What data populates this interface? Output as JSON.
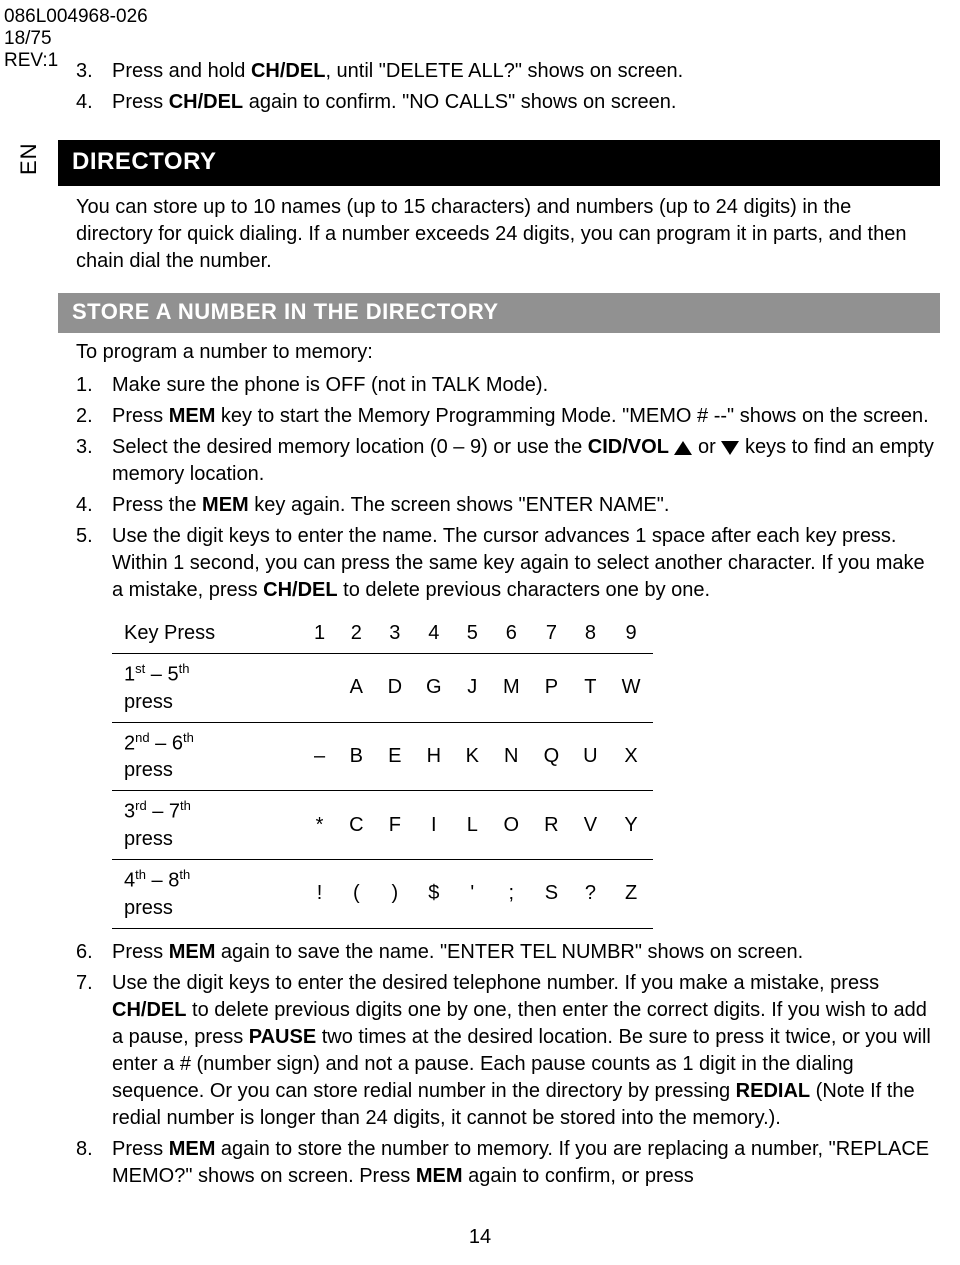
{
  "meta": {
    "code": "086L004968-026",
    "page": "18/75",
    "rev": "REV:1"
  },
  "side_lang": "EN",
  "intro_list": [
    {
      "n": "3.",
      "segs": [
        {
          "t": "Press and hold "
        },
        {
          "t": "CH/DEL",
          "b": true
        },
        {
          "t": ", until \"DELETE ALL?\" shows on screen."
        }
      ]
    },
    {
      "n": "4.",
      "segs": [
        {
          "t": "Press "
        },
        {
          "t": "CH/DEL",
          "b": true
        },
        {
          "t": " again to confirm. \"NO CALLS\" shows on screen."
        }
      ]
    }
  ],
  "h1": "DIRECTORY",
  "directory_intro": "You can store up to 10 names (up to 15 characters) and numbers (up to 24 digits) in the directory for quick dialing. If a number exceeds 24 digits, you can program it in parts, and then chain dial the number.",
  "h2": "STORE A NUMBER IN THE DIRECTORY",
  "store_lead": "To program a number to memory:",
  "store_list": [
    {
      "n": "1.",
      "segs": [
        {
          "t": "Make sure the phone is OFF (not in TALK Mode)."
        }
      ]
    },
    {
      "n": "2.",
      "segs": [
        {
          "t": "Press "
        },
        {
          "t": "MEM",
          "b": true
        },
        {
          "t": " key to start the Memory Programming Mode.  \"MEMO # --\"  shows on the screen."
        }
      ]
    },
    {
      "n": "3.",
      "segs": [
        {
          "t": "Select the desired memory location (0 – 9) or use the "
        },
        {
          "t": "CID/VOL",
          "b": true
        },
        {
          "t": " "
        },
        {
          "icon": "up"
        },
        {
          "t": " or "
        },
        {
          "icon": "down"
        },
        {
          "t": " keys to find an empty memory location."
        }
      ]
    },
    {
      "n": "4.",
      "segs": [
        {
          "t": "Press the "
        },
        {
          "t": "MEM",
          "b": true
        },
        {
          "t": " key again.  The screen shows \"ENTER NAME\"."
        }
      ]
    },
    {
      "n": "5.",
      "segs": [
        {
          "t": "Use the digit keys to enter the name.  The cursor advances 1 space after each key press.  Within 1 second, you can press the same key again to select another character. If you make a mistake, press "
        },
        {
          "t": "CH/DEL",
          "b": true
        },
        {
          "t": " to delete previous characters one by one."
        }
      ]
    }
  ],
  "char_table": {
    "header": [
      "Key Press",
      "1",
      "2",
      "3",
      "4",
      "5",
      "6",
      "7",
      "8",
      "9"
    ],
    "rows": [
      {
        "label_html": "1<sup>st</sup> – 5<sup>th</sup> press",
        "cells": [
          "",
          "A",
          "D",
          "G",
          "J",
          "M",
          "P",
          "T",
          "W"
        ]
      },
      {
        "label_html": "2<sup>nd</sup> – 6<sup>th</sup> press",
        "cells": [
          "–",
          "B",
          "E",
          "H",
          "K",
          "N",
          "Q",
          "U",
          "X"
        ]
      },
      {
        "label_html": "3<sup>rd</sup> – 7<sup>th</sup> press",
        "cells": [
          "*",
          "C",
          "F",
          "I",
          "L",
          "O",
          "R",
          "V",
          "Y"
        ]
      },
      {
        "label_html": "4<sup>th</sup> – 8<sup>th</sup> press",
        "cells": [
          "!",
          "(",
          ")",
          "$",
          "'",
          ";",
          "S",
          "?",
          "Z"
        ]
      }
    ]
  },
  "store_list2": [
    {
      "n": "6.",
      "segs": [
        {
          "t": "Press "
        },
        {
          "t": "MEM",
          "b": true
        },
        {
          "t": " again to save the name.  \"ENTER TEL NUMBR\" shows on screen."
        }
      ]
    },
    {
      "n": "7.",
      "segs": [
        {
          "t": "Use the digit keys to enter the desired telephone number. If you make a mistake, press "
        },
        {
          "t": "CH/DEL",
          "b": true
        },
        {
          "t": " to delete previous digits one by one, then enter the correct digits. If you wish to add a pause, press "
        },
        {
          "t": "PAUSE",
          "b": true
        },
        {
          "t": " two times at the desired location. Be sure to press it twice, or you will enter a # (number sign) and not a pause.  Each pause counts as 1 digit in the dialing sequence. Or you can store redial number in the directory by pressing "
        },
        {
          "t": "REDIAL",
          "b": true
        },
        {
          "t": " (Note If the redial number is longer than 24 digits, it cannot be stored into the memory.)."
        }
      ]
    },
    {
      "n": "8.",
      "segs": [
        {
          "t": "Press "
        },
        {
          "t": "MEM",
          "b": true
        },
        {
          "t": " again to store the number to memory.  If you are replacing a number, \"REPLACE MEMO?\" shows on screen.  Press "
        },
        {
          "t": "MEM",
          "b": true
        },
        {
          "t": " again to confirm, or press"
        }
      ]
    }
  ],
  "page_number": "14"
}
